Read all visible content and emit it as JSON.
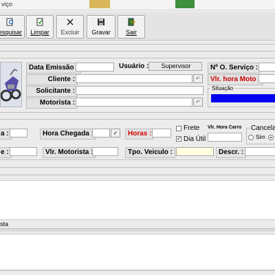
{
  "window": {
    "title": "viço"
  },
  "toolbar": {
    "pesquisar": "esquisar",
    "limpar": "Limpar",
    "excluir": "Excluir",
    "gravar": "Gravar",
    "sair": "Sair"
  },
  "header_form": {
    "data_emissao_label": "Data Emissão :",
    "data_emissao_value": "",
    "usuario_label": "Usuário :",
    "usuario_value": "Supervisor",
    "cliente_label": "Cliente :",
    "solicitante_label": "Solicitante :",
    "motorista_label": "Motorista :",
    "os_label": "Nº O. Serviço :",
    "vlr_hora_moto_label": "Vlr. hora Moto :",
    "situacao_label": "Situação",
    "situacao_color": "#0000ee"
  },
  "service_form": {
    "hora_saida_label": "a :",
    "hora_chegada_label": "Hora Chegada :",
    "horas_label": "Horas :",
    "frete_label": "Frete",
    "dia_util_label": "Dia Útil",
    "dia_util_checked": true,
    "vlr_hora_carro_label": "Vlr. Hora Carro",
    "cancelado_label": "Cancelad",
    "sim_label": "Sim",
    "nao_selected": true,
    "row2_left_label": "e :",
    "vlr_motorista_label": "Vlr. Motorista :",
    "tpo_veiculo_label": "Tpo. Veiculo :",
    "descr_label": "Descr. :"
  },
  "bottom": {
    "section_label": "sta"
  }
}
